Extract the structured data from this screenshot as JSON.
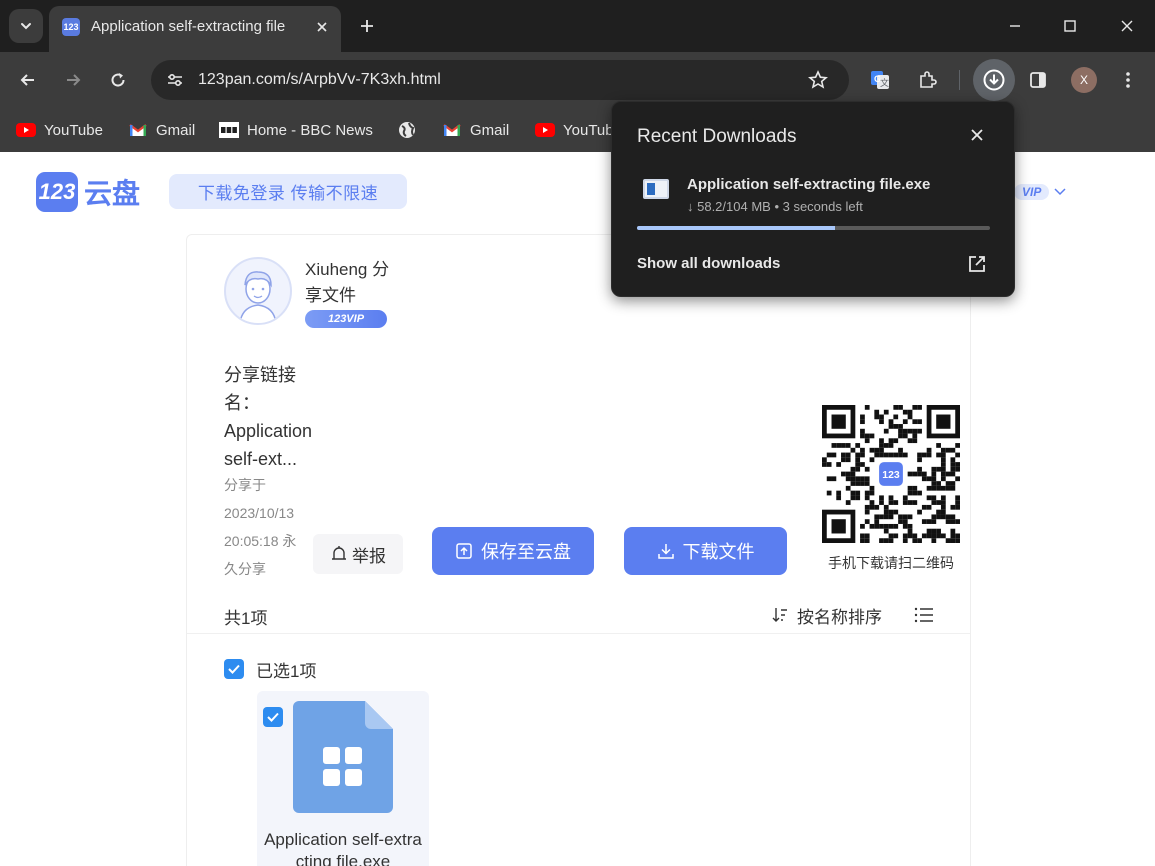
{
  "browser": {
    "tab": {
      "favicon_text": "123",
      "title": "Application self-extracting file"
    },
    "url": "123pan.com/s/ArpbVv-7K3xh.html",
    "profile_initial": "X",
    "bookmarks": [
      {
        "label": "YouTube",
        "icon": "youtube-icon"
      },
      {
        "label": "Gmail",
        "icon": "gmail-icon"
      },
      {
        "label": "Home - BBC News",
        "icon": "bbc-icon"
      },
      {
        "label": "",
        "icon": "globe-icon"
      },
      {
        "label": "Gmail",
        "icon": "gmail-icon"
      },
      {
        "label": "YouTube",
        "icon": "youtube-icon"
      }
    ]
  },
  "downloads": {
    "title": "Recent Downloads",
    "file_name": "Application self-extracting file.exe",
    "status": "↓ 58.2/104 MB • 3 seconds left",
    "progress_fraction": 0.56,
    "show_all": "Show all downloads"
  },
  "page": {
    "logo_badge": "123",
    "logo_text": "云盘",
    "promo": "下载免登录   传输不限速",
    "header_vip": "VIP",
    "user": {
      "name": "Xiuheng 分享文件",
      "vip": "123VIP"
    },
    "share": {
      "name": "分享链接名：Application self-ext...",
      "time": "分享于 2023/10/13 20:05:18 永久分享"
    },
    "buttons": {
      "report": "举报",
      "save": "保存至云盘",
      "download": "下载文件"
    },
    "qr_caption": "手机下载请扫二维码",
    "qr_center": "123",
    "count": "共1项",
    "sort": "按名称排序",
    "selected": "已选1项",
    "file": {
      "name": "Application self-extracting file.exe"
    }
  },
  "colors": {
    "brand": "#5b7ef0",
    "checkbox": "#2d8cf0",
    "progress": "#a8c7fa",
    "file_icon": "#6fa3e6"
  }
}
